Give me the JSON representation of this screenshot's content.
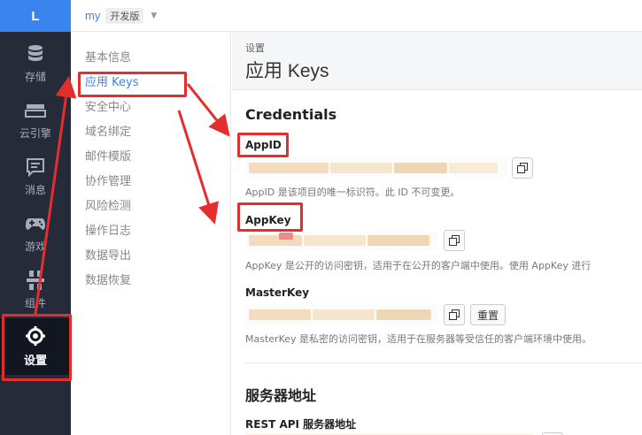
{
  "app_logo": "L",
  "topbar": {
    "app_name": "my",
    "env_badge": "开发版",
    "caret": "▼"
  },
  "rail": {
    "items": [
      {
        "label": "存储",
        "icon": "database-icon"
      },
      {
        "label": "云引擎",
        "icon": "engine-icon"
      },
      {
        "label": "消息",
        "icon": "message-icon"
      },
      {
        "label": "游戏",
        "icon": "gamepad-icon"
      },
      {
        "label": "组件",
        "icon": "components-icon"
      },
      {
        "label": "设置",
        "icon": "gear-icon",
        "active": true
      }
    ]
  },
  "subnav": {
    "items": [
      "基本信息",
      "应用 Keys",
      "安全中心",
      "域名绑定",
      "邮件模版",
      "协作管理",
      "风险检测",
      "操作日志",
      "数据导出",
      "数据恢复"
    ],
    "active_index": 1
  },
  "page": {
    "breadcrumb": "设置",
    "title": "应用 Keys"
  },
  "credentials": {
    "heading": "Credentials",
    "app_id": {
      "label": "AppID",
      "help": "AppID 是该项目的唯一标识符。此 ID 不可变更。"
    },
    "app_key": {
      "label": "AppKey",
      "help": "AppKey 是公开的访问密钥，适用于在公开的客户端中使用。使用 AppKey 进行"
    },
    "master_key": {
      "label": "MasterKey",
      "help": "MasterKey 是私密的访问密钥，适用于在服务器等受信任的客户端环境中使用。",
      "reset_label": "重置"
    }
  },
  "server": {
    "heading": "服务器地址",
    "rest_api_label": "REST API 服务器地址"
  },
  "colors": {
    "accent": "#3a84ee",
    "rail_bg": "#252b39",
    "annotation_red": "#e42d2d"
  }
}
